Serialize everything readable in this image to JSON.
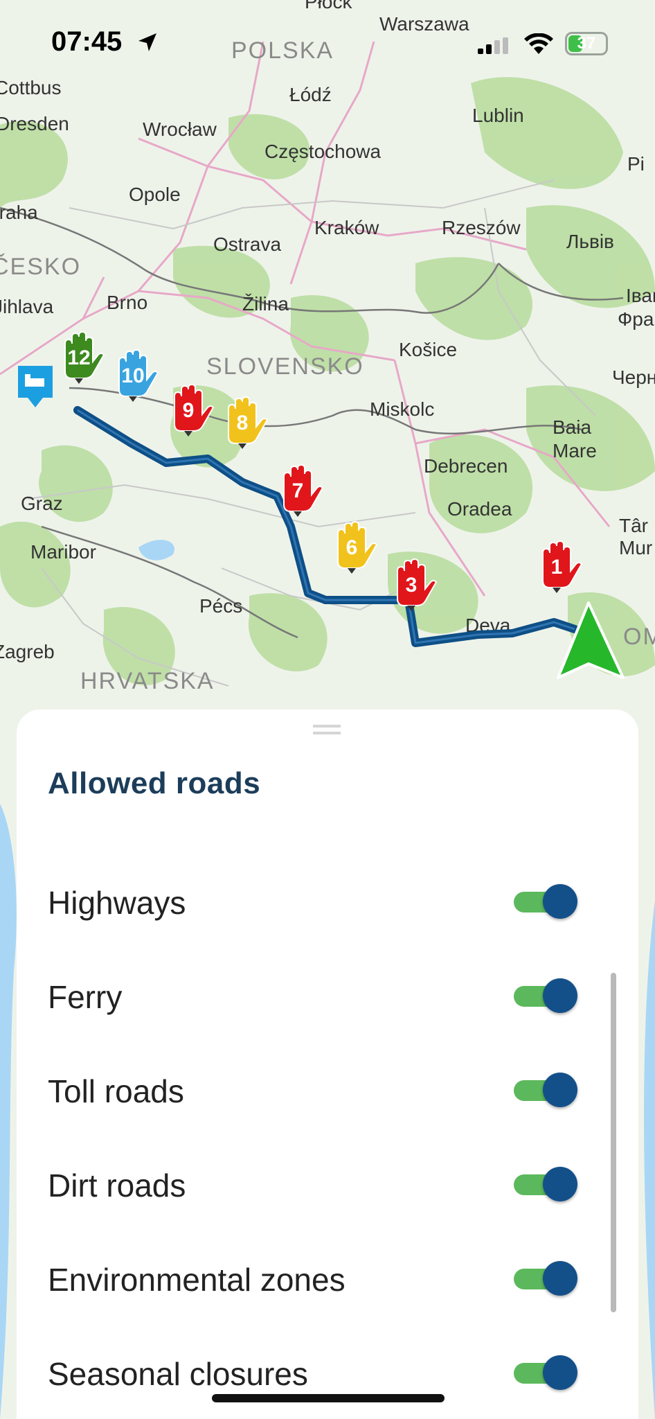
{
  "status_bar": {
    "time": "07:45",
    "battery_percent": "37"
  },
  "map": {
    "cities": [
      "Płock",
      "Warszawa",
      "Cottbus",
      "Łódź",
      "Lublin",
      "Wrocław",
      "Częstochowa",
      "Opole",
      "Kraków",
      "Rzeszów",
      "Львів",
      "Ostrava",
      "Brno",
      "Žilina",
      "Košice",
      "Miskolc",
      "Debrecen",
      "Oradea",
      "Baia",
      "Mare",
      "Graz",
      "Maribor",
      "Pécs",
      "Deva",
      "Чернівці",
      "Івано-Франківськ",
      "Praha",
      "Dresden",
      "Jihlava",
      "Zagreb",
      "Târgu Mureș"
    ],
    "countries": [
      "POLSKA",
      "ČESKO",
      "SLOVENSKO",
      "HRVATSKA",
      "ROMÂNIA"
    ],
    "waypoints": [
      {
        "label": "12",
        "color": "#3d8a1f"
      },
      {
        "label": "10",
        "color": "#39a3e0"
      },
      {
        "label": "9",
        "color": "#e0161b"
      },
      {
        "label": "8",
        "color": "#f2c21c"
      },
      {
        "label": "7",
        "color": "#e0161b"
      },
      {
        "label": "6",
        "color": "#f2c21c"
      },
      {
        "label": "3",
        "color": "#e0161b"
      },
      {
        "label": "1",
        "color": "#e0161b"
      }
    ],
    "route_color": "#0e4f86",
    "position_color": "#26b72b"
  },
  "sheet": {
    "title": "Allowed roads",
    "options": [
      {
        "label": "Highways",
        "enabled": true
      },
      {
        "label": "Ferry",
        "enabled": true
      },
      {
        "label": "Toll roads",
        "enabled": true
      },
      {
        "label": "Dirt roads",
        "enabled": true
      },
      {
        "label": "Environmental zones",
        "enabled": true
      },
      {
        "label": "Seasonal closures",
        "enabled": true
      }
    ]
  }
}
